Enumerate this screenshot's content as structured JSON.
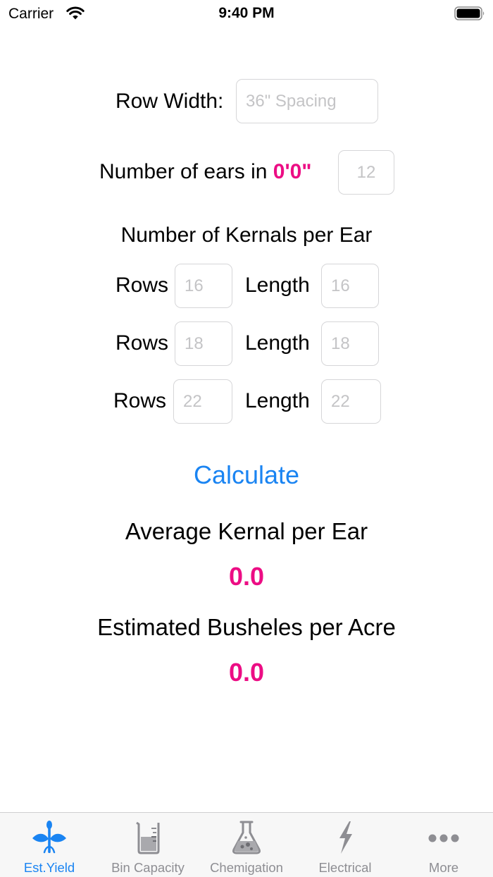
{
  "status_bar": {
    "carrier": "Carrier",
    "time": "9:40 PM"
  },
  "form": {
    "row_width_label": "Row Width:",
    "row_width_placeholder": "36\" Spacing",
    "ears_label": "Number of ears in",
    "ears_distance": "0'0\"",
    "ears_placeholder": "12",
    "kernels_heading": "Number of Kernals per Ear",
    "rows_label": "Rows",
    "length_label": "Length",
    "kernel_rows": [
      {
        "rows_placeholder": "16",
        "length_placeholder": "16"
      },
      {
        "rows_placeholder": "18",
        "length_placeholder": "18"
      },
      {
        "rows_placeholder": "22",
        "length_placeholder": "22"
      }
    ]
  },
  "calculate_label": "Calculate",
  "results": {
    "avg_kernel_title": "Average Kernal per Ear",
    "avg_kernel_value": "0.0",
    "bushels_title": "Estimated Busheles per Acre",
    "bushels_value": "0.0"
  },
  "tab_bar": {
    "tabs": [
      {
        "label": "Est.Yield",
        "icon": "plant-icon",
        "active": true
      },
      {
        "label": "Bin Capacity",
        "icon": "beaker-icon",
        "active": false
      },
      {
        "label": "Chemigation",
        "icon": "flask-icon",
        "active": false
      },
      {
        "label": "Electrical",
        "icon": "lightning-icon",
        "active": false
      },
      {
        "label": "More",
        "icon": "more-icon",
        "active": false
      }
    ]
  },
  "colors": {
    "accent": "#ec0d84",
    "tint": "#1a84f2",
    "inactive": "#8e8e93",
    "placeholder": "#c4c4c6"
  }
}
